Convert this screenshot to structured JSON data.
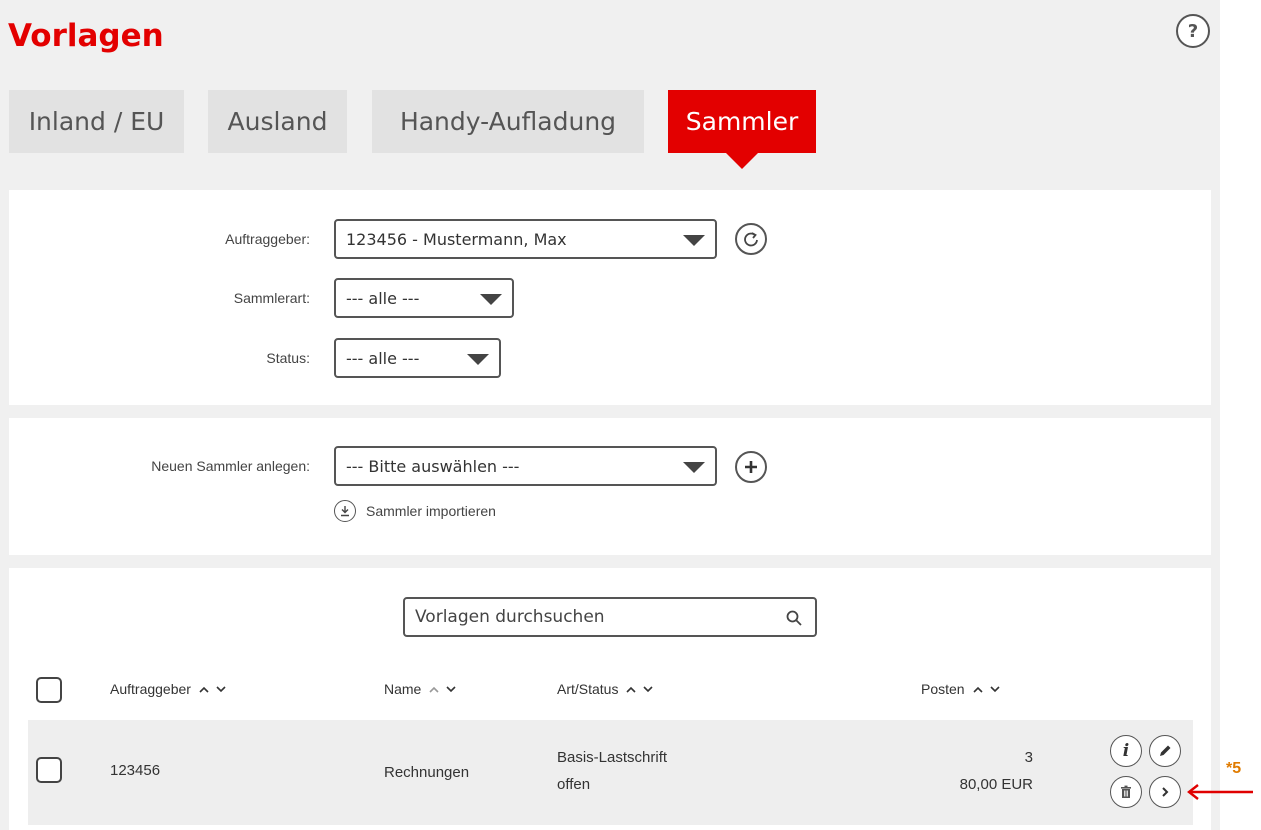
{
  "page": {
    "title": "Vorlagen",
    "help_label": "?"
  },
  "tabs": [
    {
      "label": "Inland / EU"
    },
    {
      "label": "Ausland"
    },
    {
      "label": "Handy-Aufladung"
    },
    {
      "label": "Sammler"
    }
  ],
  "filter": {
    "auftraggeber_label": "Auftraggeber:",
    "auftraggeber_value": "123456 - Mustermann, Max",
    "sammlerart_label": "Sammlerart:",
    "sammlerart_value": "--- alle ---",
    "status_label": "Status:",
    "status_value": "--- alle ---"
  },
  "create": {
    "label": "Neuen Sammler anlegen:",
    "select_value": "--- Bitte auswählen ---",
    "import_label": "Sammler importieren"
  },
  "search": {
    "placeholder": "Vorlagen durchsuchen"
  },
  "table": {
    "headers": [
      "Auftraggeber",
      "Name",
      "Art/Status",
      "Posten"
    ],
    "rows": [
      {
        "auftraggeber": "123456",
        "name": "Rechnungen",
        "art": "Basis-Lastschrift",
        "status": "offen",
        "posten_count": "3",
        "posten_amount": "80,00 EUR"
      }
    ]
  },
  "annotation": {
    "label": "*5"
  },
  "colors": {
    "accent": "#e30000",
    "annotation": "#e07b00",
    "arrow": "#e00000"
  }
}
